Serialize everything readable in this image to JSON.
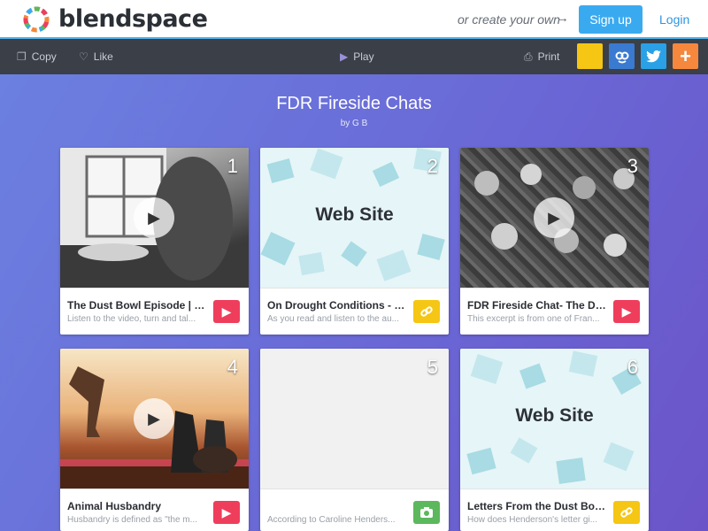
{
  "brand": {
    "name": "blendspace"
  },
  "topbar": {
    "create_text": "or create your own",
    "signup_label": "Sign up",
    "login_label": "Login"
  },
  "toolbar": {
    "copy_label": "Copy",
    "like_label": "Like",
    "play_label": "Play",
    "print_label": "Print"
  },
  "lesson": {
    "title": "FDR Fireside Chats",
    "byline": "by G B"
  },
  "cards": [
    {
      "number": "1",
      "title": "The Dust Bowl Episode | U...",
      "desc": "Listen to the video, turn and tal...",
      "type": "video"
    },
    {
      "number": "2",
      "title": "On Drought Conditions - N...",
      "desc": "As you read and listen to the au...",
      "type": "link",
      "thumb_text": "Web Site"
    },
    {
      "number": "3",
      "title": "FDR Fireside Chat- The Du...",
      "desc": "This excerpt is from one of Fran...",
      "type": "video"
    },
    {
      "number": "4",
      "title": "Animal Husbandry",
      "desc": "Husbandry is defined as \"the m...",
      "type": "video"
    },
    {
      "number": "5",
      "title": "",
      "desc": "According to Caroline Henders...",
      "type": "image"
    },
    {
      "number": "6",
      "title": "Letters From the Dust Bow...",
      "desc": "How does Henderson's letter gi...",
      "type": "link",
      "thumb_text": "Web Site"
    }
  ],
  "colors": {
    "accent": "#3aaaf0",
    "video": "#ef3e5c",
    "link": "#f5c613",
    "image": "#5cb85c",
    "toolbar": "#3a3f48"
  }
}
